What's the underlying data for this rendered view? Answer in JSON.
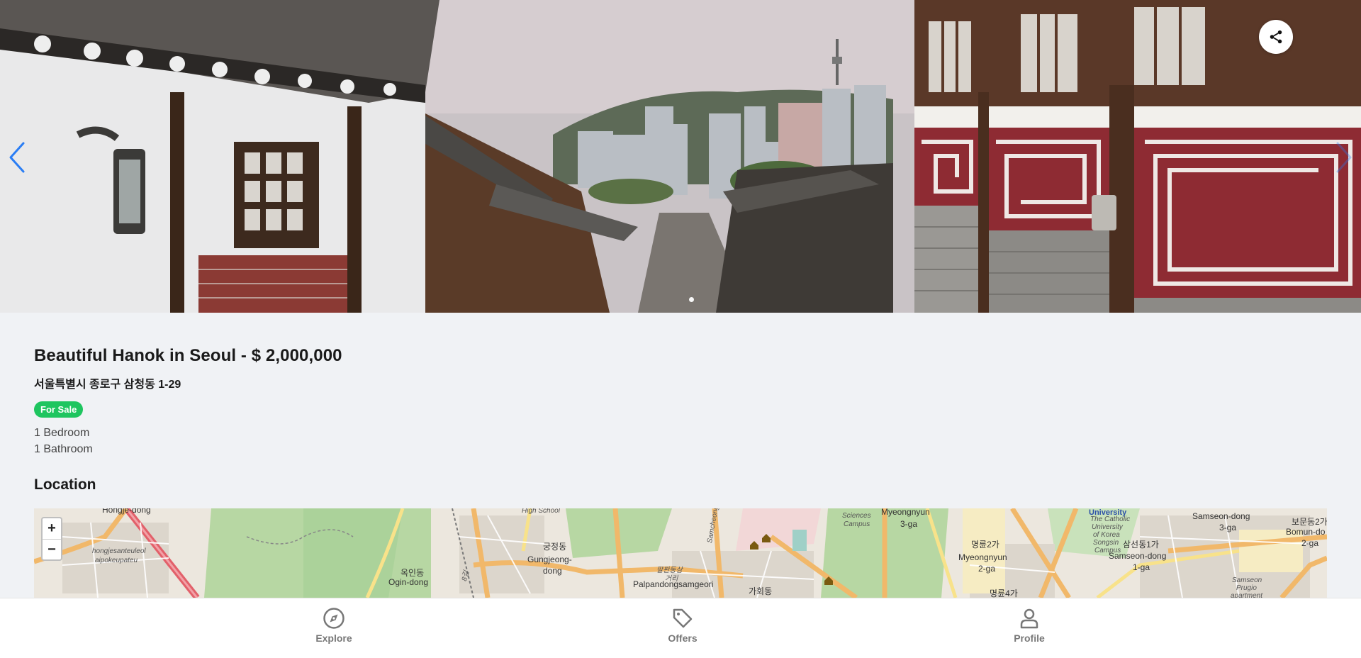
{
  "listing": {
    "title": "Beautiful Hanok in Seoul - $ 2,000,000",
    "address": "서울특별시 종로구 삼청동 1-29",
    "status_badge": "For Sale",
    "bedrooms": "1 Bedroom",
    "bathrooms": "1 Bathroom"
  },
  "gallery": {
    "prev_icon": "chevron-left-icon",
    "next_icon": "chevron-right-icon",
    "share_icon": "share-icon",
    "slide_count": 1,
    "active_slide": 1
  },
  "location": {
    "heading": "Location",
    "zoom_in": "+",
    "zoom_out": "−",
    "labels": {
      "hongje": "Hongje-dong",
      "hongjesan": "hongjesanteuleol",
      "aipoke": "aipokeupateu",
      "oginkr": "옥인동",
      "ogin": "Ogin-dong",
      "highschool": "High School",
      "gungjeongkr": "궁정동",
      "gungjeong1": "Gungjeong-",
      "gungjeong2": "dong",
      "palpan": "팔판동삼",
      "geori": "거리",
      "palpandong": "Palpandongsamgeori",
      "samcheong": "Samcheong-ro",
      "gahoe": "가회동",
      "sciences": "Sciences",
      "campus": "Campus",
      "myeongnyun3a": "Myeongnyun",
      "myeongnyun3b": "3-ga",
      "myeongnyun2kr": "명륜2가",
      "myeongnyun2a": "Myeongnyun",
      "myeongnyun2b": "2-ga",
      "myeongnyun4kr": "명륜4가",
      "university": "University",
      "catholic1": "The Catholic",
      "catholic2": "University",
      "catholic3": "of Korea",
      "catholic4": "Songsin",
      "catholic5": "Campus",
      "samseon1kr": "삼선동1가",
      "samseon1a": "Samseon-dong",
      "samseon1b": "1-ga",
      "samseon3a": "Samseon-dong",
      "samseon3b": "3-ga",
      "samseonprugio1": "Samseon",
      "samseonprugio2": "Prugio",
      "samseonprugio3": "apartment",
      "bomun1": "보문동2가",
      "bomun2": "Bomun-do",
      "bomun3": "2-ga",
      "bukchon": "8길"
    }
  },
  "bottom_nav": {
    "items": [
      {
        "label": "Explore",
        "icon": "compass-icon"
      },
      {
        "label": "Offers",
        "icon": "tag-icon"
      },
      {
        "label": "Profile",
        "icon": "user-icon"
      }
    ]
  },
  "colors": {
    "accent": "#2a7df4",
    "badge": "#1ec55f",
    "background": "#f0f2f5",
    "nav_text": "#777777"
  }
}
